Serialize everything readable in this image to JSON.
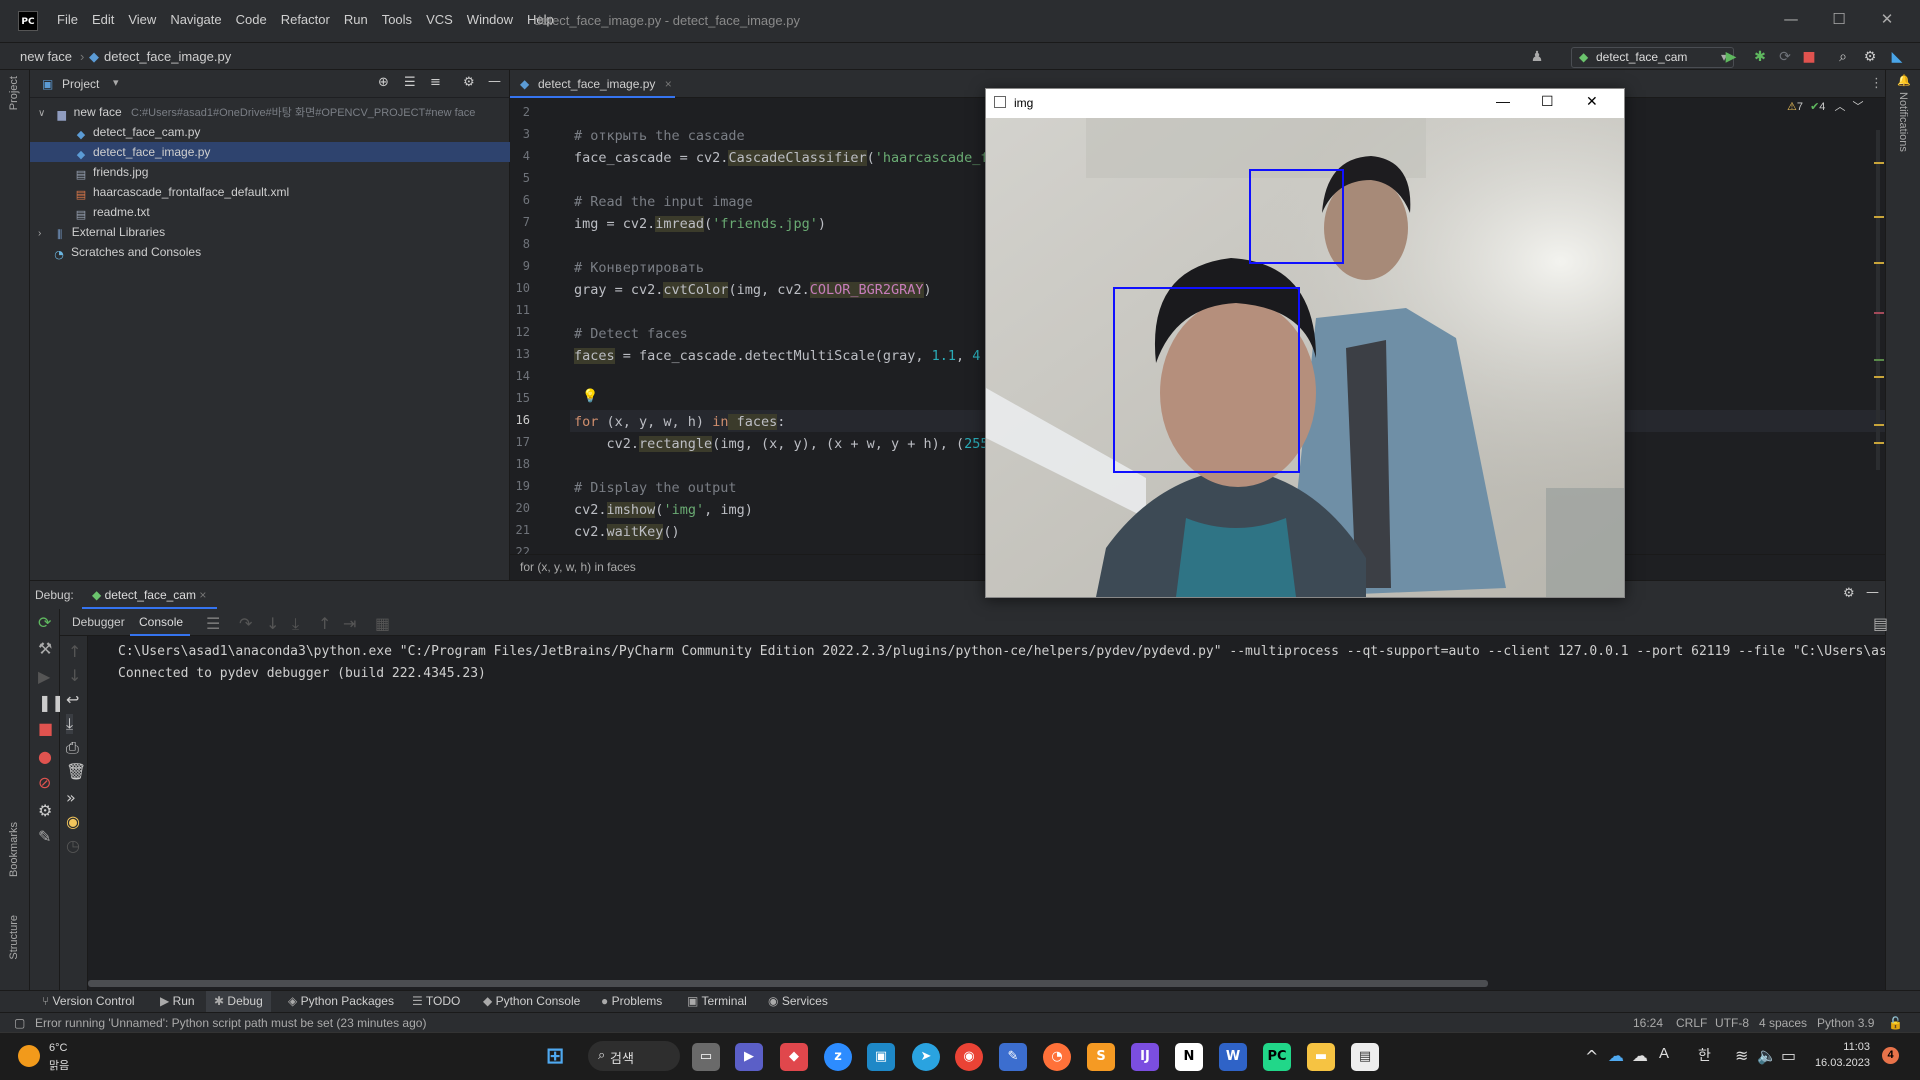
{
  "app": {
    "logo": "PC",
    "window_title": "detect_face_image.py - detect_face_image.py"
  },
  "menu": [
    "File",
    "Edit",
    "View",
    "Navigate",
    "Code",
    "Refactor",
    "Run",
    "Tools",
    "VCS",
    "Window",
    "Help"
  ],
  "navbar": {
    "project": "new face",
    "file": "detect_face_image.py",
    "run_config": "detect_face_cam"
  },
  "project_panel": {
    "title": "Project",
    "root_name": "new face",
    "root_path": "C:#Users#asad1#OneDrive#바탕 화면#OPENCV_PROJECT#new face",
    "files": [
      {
        "name": "detect_face_cam.py",
        "icon": "python-file-icon"
      },
      {
        "name": "detect_face_image.py",
        "icon": "python-file-icon"
      },
      {
        "name": "friends.jpg",
        "icon": "image-file-icon"
      },
      {
        "name": "haarcascade_frontalface_default.xml",
        "icon": "xml-file-icon"
      },
      {
        "name": "readme.txt",
        "icon": "text-file-icon"
      }
    ],
    "external": "External Libraries",
    "scratches": "Scratches and Consoles"
  },
  "editor": {
    "tab": "detect_face_image.py",
    "breadcrumb": "for (x, y, w, h) in faces",
    "line_numbers": [
      "2",
      "3",
      "4",
      "5",
      "6",
      "7",
      "8",
      "9",
      "10",
      "11",
      "12",
      "13",
      "14",
      "15",
      "16",
      "17",
      "18",
      "19",
      "20",
      "21",
      "22"
    ],
    "inspection": {
      "warnings": "7",
      "checks": "4"
    }
  },
  "code_text": {
    "c3": "# открыть the cascade",
    "l4a": "face_cascade = cv2.",
    "l4b": "CascadeClassifier",
    "l4c": "(",
    "l4d": "'haarcascade_fr",
    "c6": "# Read the input image",
    "l7a": "img = cv2.",
    "l7b": "imread",
    "l7c": "(",
    "l7d": "'friends.jpg'",
    "l7e": ")",
    "c9": "# Конвертировать",
    "l10a": "gray = cv2.",
    "l10b": "cvtColor",
    "l10c": "(img, cv2.",
    "l10d": "COLOR_BGR2GRAY",
    "l10e": ")",
    "c12": "# Detect faces",
    "l13a": "faces",
    "l13b": " = face_cascade.detectMultiScale(gray, ",
    "l13c": "1.1",
    "l13d": ", ",
    "l13e": "4",
    "l16a": "for",
    "l16b": " (x, y, w, h) ",
    "l16c": "in",
    "l16d": " faces",
    ":": ":",
    "l17a": "    cv2.",
    "l17b": "rectangle",
    "l17c": "(img, (x, y), (x + w, y + h), (",
    "l17d": "255",
    "c19": "# Display the output",
    "l20a": "cv2.",
    "l20b": "imshow",
    "l20c": "(",
    "l20d": "'img'",
    "l20e": ", img)",
    "l21a": "cv2.",
    "l21b": "waitKey",
    "l21c": "()"
  },
  "debug": {
    "label": "Debug:",
    "config": "detect_face_cam",
    "tabs": [
      "Debugger",
      "Console"
    ],
    "console_lines": [
      "C:\\Users\\asad1\\anaconda3\\python.exe \"C:/Program Files/JetBrains/PyCharm Community Edition 2022.2.3/plugins/python-ce/helpers/pydev/pydevd.py\" --multiprocess --qt-support=auto --client 127.0.0.1 --port 62119 --file \"C:\\Users\\as",
      "Connected to pydev debugger (build 222.4345.23)"
    ]
  },
  "tool_tabs": [
    "Version Control",
    "Run",
    "Debug",
    "Python Packages",
    "TODO",
    "Python Console",
    "Problems",
    "Terminal",
    "Services"
  ],
  "side_labels": {
    "project": "Project",
    "bookmarks": "Bookmarks",
    "structure": "Structure",
    "notifications": "Notifications"
  },
  "status": {
    "message": "Error running 'Unnamed': Python script path must be set (23 minutes ago)",
    "position": "16:24",
    "line_sep": "CRLF",
    "encoding": "UTF-8",
    "indent": "4 spaces",
    "interpreter": "Python 3.9"
  },
  "img_window": {
    "title": "img"
  },
  "taskbar": {
    "weather_temp": "6°C",
    "weather_desc": "맑음",
    "search": "검색",
    "time": "11:03",
    "date": "16.03.2023",
    "notif_count": "4",
    "ime_lang": "A",
    "ime_han": "한"
  }
}
